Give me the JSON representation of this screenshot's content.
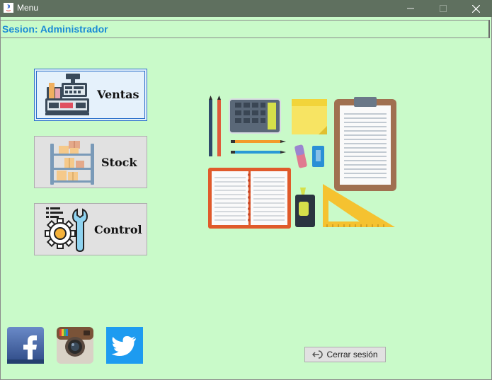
{
  "window": {
    "title": "Menu"
  },
  "session": {
    "text": "Sesion: Administrador"
  },
  "menu": {
    "ventas": {
      "label": "Ventas",
      "icon": "cash-register-icon"
    },
    "stock": {
      "label": "Stock",
      "icon": "warehouse-shelf-icon"
    },
    "control": {
      "label": "Control",
      "icon": "gear-wrench-icon"
    }
  },
  "illustration": {
    "icon": "office-supplies-illustration"
  },
  "social": {
    "facebook": {
      "icon": "facebook-icon",
      "color": "#3b5998"
    },
    "instagram": {
      "icon": "instagram-icon",
      "color": "#8a6a4e"
    },
    "twitter": {
      "icon": "twitter-icon",
      "color": "#1d9bf0"
    }
  },
  "logout": {
    "label": "Cerrar sesión",
    "icon": "logout-icon"
  },
  "colors": {
    "background": "#c9fac9",
    "accent": "#1a8bd6",
    "titlebar": "#5f705f"
  }
}
